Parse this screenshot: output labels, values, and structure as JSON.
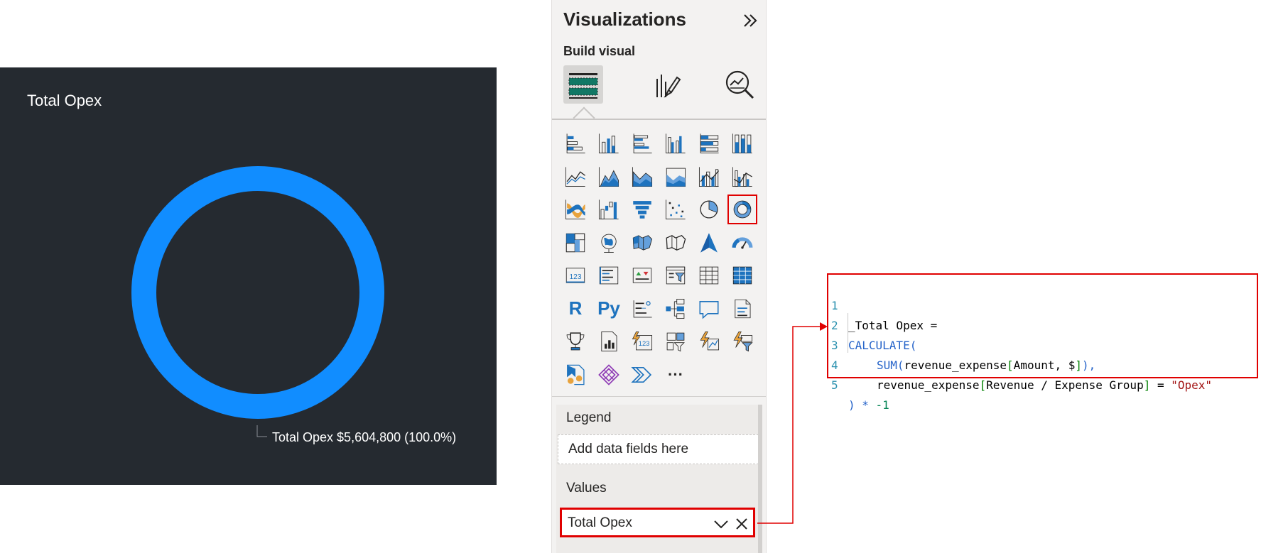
{
  "chart_card": {
    "title": "Total Opex",
    "background": "#252a30",
    "ring_color": "#118dff",
    "data_label": "Total Opex $5,604,800 (100.0%)"
  },
  "chart_data": {
    "type": "pie",
    "title": "Total Opex",
    "donut": true,
    "series": [
      {
        "name": "Total Opex",
        "value": 5604800,
        "percent": 100.0,
        "color": "#118dff"
      }
    ]
  },
  "viz_pane": {
    "title": "Visualizations",
    "subtitle": "Build visual",
    "collapse_icon": "double-chevron-right-icon",
    "modes": [
      "build-visual-icon",
      "format-visual-icon",
      "analytics-icon"
    ],
    "icons": [
      "stacked-bar-chart-icon",
      "stacked-column-chart-icon",
      "clustered-bar-chart-icon",
      "clustered-column-chart-icon",
      "100-stacked-bar-chart-icon",
      "100-stacked-column-chart-icon",
      "line-chart-icon",
      "area-chart-icon",
      "stacked-area-chart-icon",
      "100-stacked-area-chart-icon",
      "line-and-stacked-column-chart-icon",
      "line-and-clustered-column-chart-icon",
      "ribbon-chart-icon",
      "waterfall-chart-icon",
      "funnel-icon",
      "scatter-chart-icon",
      "pie-chart-icon",
      "donut-chart-icon",
      "treemap-icon",
      "map-icon",
      "filled-map-icon",
      "shape-map-icon",
      "azure-map-icon",
      "gauge-icon",
      "card-icon",
      "multi-row-card-icon",
      "kpi-icon",
      "slicer-icon",
      "table-icon",
      "matrix-icon",
      "r-script-visual-icon",
      "python-visual-icon",
      "key-influencers-icon",
      "decomposition-tree-icon",
      "qa-icon",
      "smart-narrative-icon",
      "metrics-icon",
      "paginated-report-icon",
      "power-apps-card-icon",
      "power-apps-slicer-icon",
      "power-automate-icon",
      "power-apps-filter-icon",
      "power-apps-icon",
      "power-apps-diamond-icon",
      "power-automate-chevron-icon",
      "more-visuals-icon"
    ],
    "text_icons": {
      "r": "R",
      "py": "Py",
      "more": "···"
    },
    "wells": {
      "legend_label": "Legend",
      "legend_placeholder": "Add data fields here",
      "values_label": "Values",
      "values_field": "Total Opex"
    }
  },
  "code": {
    "lines": [
      {
        "n": "1",
        "text": "_Total Opex ="
      },
      {
        "n": "2",
        "text": "CALCULATE("
      },
      {
        "n": "3",
        "text": "    SUM(revenue_expense[Amount, $]),"
      },
      {
        "n": "4",
        "text": "    revenue_expense[Revenue / Expense Group] = \"Opex\""
      },
      {
        "n": "5",
        "text": ") * -1"
      }
    ],
    "parts": {
      "l1": "_Total Opex =",
      "l2_kw": "CALCULATE(",
      "l3_kw": "SUM(",
      "l3_tbl": "revenue_expense",
      "l3_lb": "[",
      "l3_col": "Amount, $",
      "l3_rb": "]",
      "l3_end": "),",
      "l4_tbl": "revenue_expense",
      "l4_lb": "[",
      "l4_col": "Revenue / Expense Group",
      "l4_rb": "]",
      "l4_eq": " = ",
      "l4_str": "\"Opex\"",
      "l5_a": ") * ",
      "l5_num": "-1"
    },
    "highlight_color": "#e00000"
  }
}
